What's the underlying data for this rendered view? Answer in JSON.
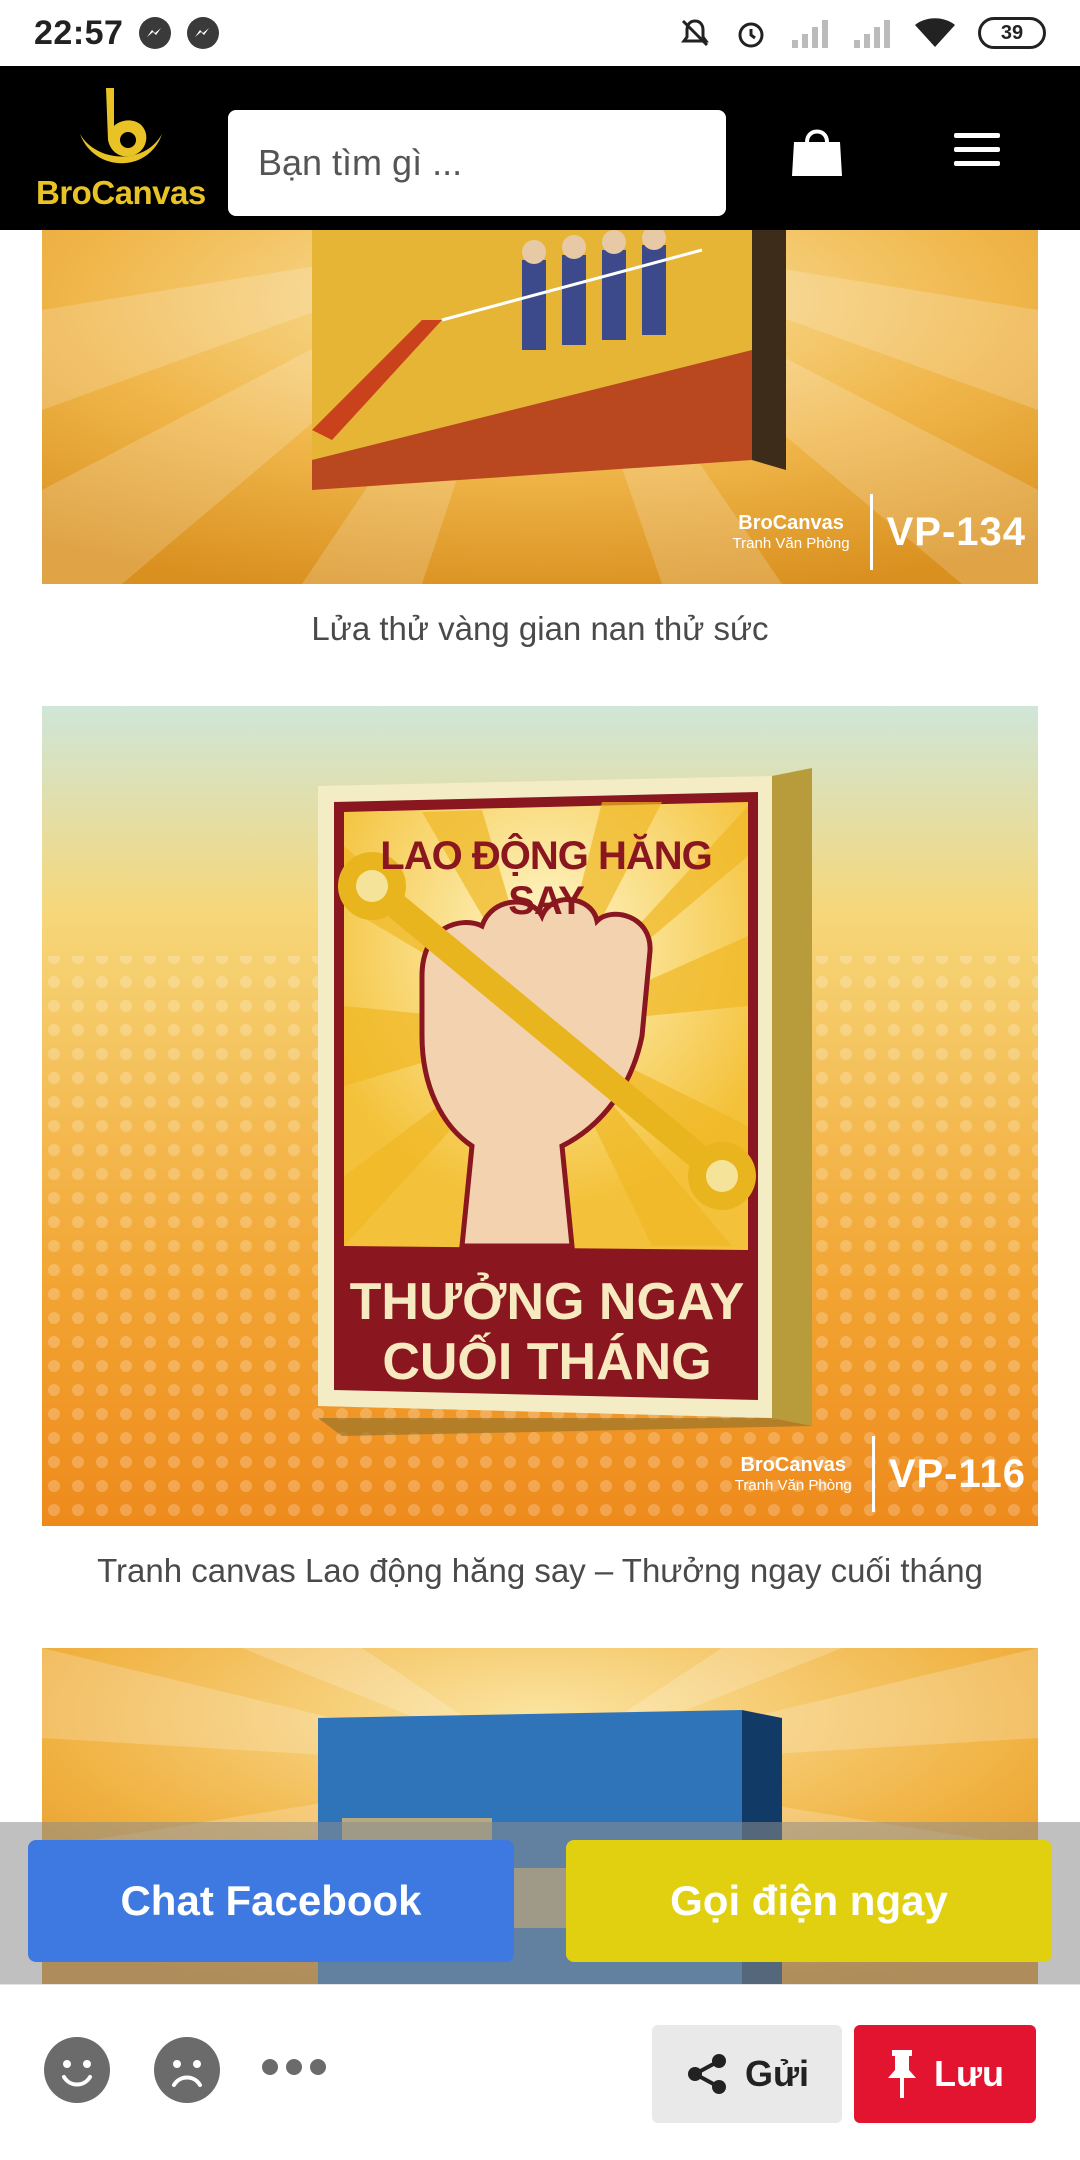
{
  "status_bar": {
    "time": "22:57",
    "battery": "39",
    "icons": [
      "messenger-icon",
      "messenger-icon",
      "mute-icon",
      "alarm-icon",
      "signal-icon",
      "signal-icon",
      "wifi-icon",
      "battery-icon"
    ]
  },
  "header": {
    "brand": "BroCanvas",
    "search_placeholder": "Bạn tìm gì ...",
    "colors": {
      "background": "#000000",
      "brand": "#e9c325"
    }
  },
  "products": [
    {
      "title": "Lửa thử vàng gian nan thử sức",
      "code": "VP-134",
      "watermark_brand": "BroCanvas",
      "watermark_sub": "Tranh Văn Phòng"
    },
    {
      "title": "Tranh canvas Lao động hăng say – Thưởng ngay cuối tháng",
      "code": "VP-116",
      "watermark_brand": "BroCanvas",
      "watermark_sub": "Tranh Văn Phòng",
      "poster_top": "LAO ĐỘNG HĂNG SAY",
      "poster_bottom_1": "THƯỞNG NGAY",
      "poster_bottom_2": "CUỐI THÁNG"
    },
    {
      "title": "",
      "code": ""
    }
  ],
  "sticky_actions": {
    "chat": "Chat Facebook",
    "call": "Gọi điện ngay",
    "colors": {
      "chat": "#3d79e0",
      "call": "#e0d010"
    }
  },
  "bottom_bar": {
    "share": "Gửi",
    "save": "Lưu",
    "colors": {
      "save": "#e3142f"
    }
  }
}
